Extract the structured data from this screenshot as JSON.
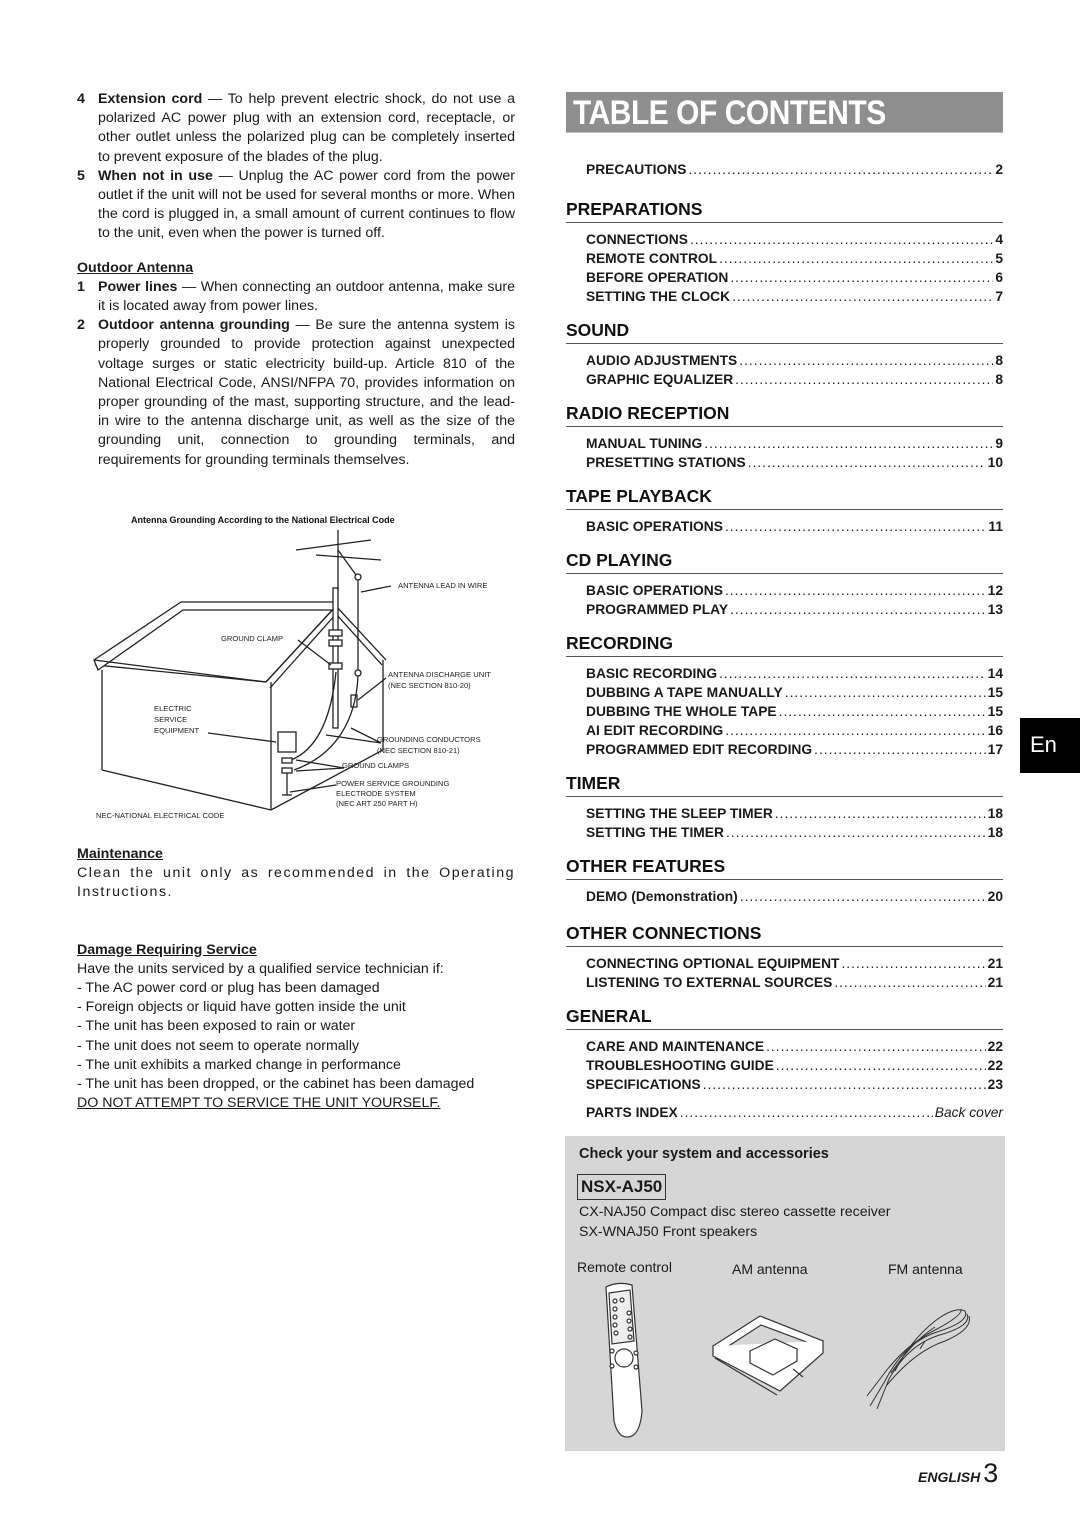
{
  "left": {
    "items": [
      {
        "num": "4",
        "bold": "Extension cord",
        "text": " — To help prevent electric shock, do not use a polarized AC power plug with an extension cord, receptacle, or other outlet unless the polarized plug can be completely inserted to prevent exposure of the blades of the plug."
      },
      {
        "num": "5",
        "bold": "When not in use",
        "text": " — Unplug the AC power cord from the power outlet if the unit will not be used for several months or more. When the cord is plugged in, a small amount of current continues to flow to the unit, even when the power is turned off."
      }
    ],
    "outdoor_antenna": {
      "heading": "Outdoor Antenna",
      "items": [
        {
          "num": "1",
          "bold": "Power lines",
          "text": " — When connecting an outdoor antenna, make sure it is located away from power lines."
        },
        {
          "num": "2",
          "bold": "Outdoor antenna grounding",
          "text": " — Be sure the antenna system is properly grounded to provide protection against unexpected voltage surges or static electricity build-up. Article 810 of the National Electrical Code, ANSI/NFPA 70, provides information on proper grounding of the mast, supporting structure, and the lead-in wire to the antenna discharge unit, as well as the size of the grounding unit, connection to grounding terminals, and requirements for grounding terminals themselves."
        }
      ]
    },
    "diagram": {
      "title": "Antenna Grounding According to the National Electrical Code",
      "labels": {
        "lead_in": "ANTENNA LEAD IN WIRE",
        "ground_clamp": "GROUND CLAMP",
        "discharge_1": "ANTENNA DISCHARGE UNIT",
        "discharge_2": "(NEC SECTION 810-20)",
        "electric_1": "ELECTRIC",
        "electric_2": "SERVICE",
        "electric_3": "EQUIPMENT",
        "conductors_1": "GROUNDING CONDUCTORS",
        "conductors_2": "(NEC SECTION 810-21)",
        "ground_clamps": "GROUND CLAMPS",
        "power_1": "POWER SERVICE GROUNDING",
        "power_2": "ELECTRODE SYSTEM",
        "power_3": "(NEC ART 250 PART H)",
        "nec": "NEC-NATIONAL ELECTRICAL CODE"
      }
    },
    "maintenance": {
      "heading": "Maintenance",
      "text": "Clean the unit only as recommended in the Operating Instructions."
    },
    "damage": {
      "heading": "Damage Requiring Service",
      "intro": "Have the units serviced by a qualified service technician if:",
      "items": [
        "- The AC power cord or plug has been damaged",
        "- Foreign objects or liquid have gotten inside the unit",
        "- The unit has been exposed to rain or water",
        "- The unit does not seem to operate normally",
        "- The unit exhibits a marked change in performance",
        "- The unit has been dropped, or the cabinet has been damaged"
      ],
      "warning": "DO NOT ATTEMPT TO SERVICE THE UNIT YOURSELF."
    }
  },
  "toc": {
    "title": "TABLE OF CONTENTS",
    "precautions": {
      "label": "PRECAUTIONS",
      "page": "2"
    },
    "sections": [
      {
        "title": "PREPARATIONS",
        "entries": [
          {
            "label": "CONNECTIONS",
            "page": "4"
          },
          {
            "label": "REMOTE CONTROL",
            "page": "5"
          },
          {
            "label": "BEFORE OPERATION",
            "page": "6"
          },
          {
            "label": "SETTING THE CLOCK",
            "page": "7"
          }
        ]
      },
      {
        "title": "SOUND",
        "entries": [
          {
            "label": "AUDIO ADJUSTMENTS",
            "page": "8"
          },
          {
            "label": "GRAPHIC EQUALIZER",
            "page": "8"
          }
        ]
      },
      {
        "title": "RADIO RECEPTION",
        "entries": [
          {
            "label": "MANUAL TUNING",
            "page": "9"
          },
          {
            "label": "PRESETTING STATIONS",
            "page": "10"
          }
        ]
      },
      {
        "title": "TAPE PLAYBACK",
        "entries": [
          {
            "label": "BASIC OPERATIONS",
            "page": "11"
          }
        ]
      },
      {
        "title": "CD PLAYING",
        "entries": [
          {
            "label": "BASIC OPERATIONS",
            "page": "12"
          },
          {
            "label": "PROGRAMMED PLAY",
            "page": "13"
          }
        ]
      },
      {
        "title": "RECORDING",
        "entries": [
          {
            "label": "BASIC RECORDING",
            "page": "14"
          },
          {
            "label": "DUBBING A TAPE MANUALLY",
            "page": "15"
          },
          {
            "label": "DUBBING THE WHOLE TAPE",
            "page": "15"
          },
          {
            "label": "AI EDIT RECORDING",
            "page": "16"
          },
          {
            "label": "PROGRAMMED EDIT RECORDING",
            "page": "17"
          }
        ]
      },
      {
        "title": "TIMER",
        "entries": [
          {
            "label": "SETTING THE SLEEP TIMER",
            "page": "18"
          },
          {
            "label": "SETTING THE TIMER",
            "page": "18"
          }
        ]
      },
      {
        "title": "OTHER FEATURES",
        "entries": [
          {
            "label": "DEMO (Demonstration)",
            "page": "20"
          }
        ]
      },
      {
        "title": "OTHER CONNECTIONS",
        "entries": [
          {
            "label": "CONNECTING OPTIONAL EQUIPMENT",
            "page": "21"
          },
          {
            "label": "LISTENING TO EXTERNAL SOURCES",
            "page": "21"
          }
        ]
      },
      {
        "title": "GENERAL",
        "entries": [
          {
            "label": "CARE AND MAINTENANCE",
            "page": "22"
          },
          {
            "label": "TROUBLESHOOTING GUIDE",
            "page": "22"
          },
          {
            "label": "SPECIFICATIONS",
            "page": "23"
          }
        ]
      }
    ],
    "parts_index": {
      "label": "PARTS INDEX",
      "page": "Back cover"
    }
  },
  "accessories": {
    "title": "Check your system and accessories",
    "model": "NSX-AJ50",
    "lines": [
      "CX-NAJ50 Compact disc stereo cassette receiver",
      "SX-WNAJ50 Front speakers"
    ],
    "items": [
      {
        "label": "Remote control",
        "icon": "remote-control-icon"
      },
      {
        "label": "AM antenna",
        "icon": "am-antenna-icon"
      },
      {
        "label": "FM antenna",
        "icon": "fm-antenna-icon"
      }
    ]
  },
  "tab": {
    "label": "En"
  },
  "footer": {
    "language": "ENGLISH",
    "page": "3"
  },
  "colors": {
    "banner": "#8e8e8e",
    "accessory_box": "#d6d6d6",
    "tab": "#000000"
  }
}
